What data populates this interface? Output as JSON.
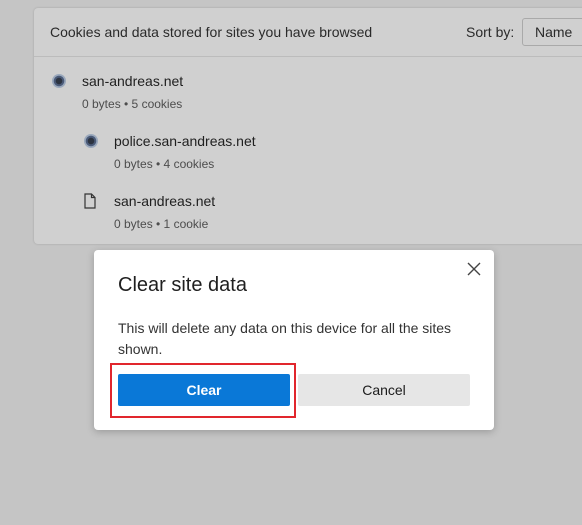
{
  "panel": {
    "title": "Cookies and data stored for sites you have browsed",
    "sort_label": "Sort by:",
    "sort_value": "Name",
    "sites": [
      {
        "name": "san-andreas.net",
        "meta": "0 bytes • 5 cookies",
        "icon": "globe-icon"
      },
      {
        "name": "police.san-andreas.net",
        "meta": "0 bytes • 4 cookies",
        "icon": "globe-icon"
      },
      {
        "name": "san-andreas.net",
        "meta": "0 bytes • 1 cookie",
        "icon": "file-icon"
      }
    ]
  },
  "dialog": {
    "title": "Clear site data",
    "body": "This will delete any data on this device for all the sites shown.",
    "clear_label": "Clear",
    "cancel_label": "Cancel",
    "close_icon": "close-icon"
  },
  "colors": {
    "primary_button": "#0a78d7",
    "highlight_border": "#e1262d",
    "overlay_background": "#c5c5c5"
  }
}
